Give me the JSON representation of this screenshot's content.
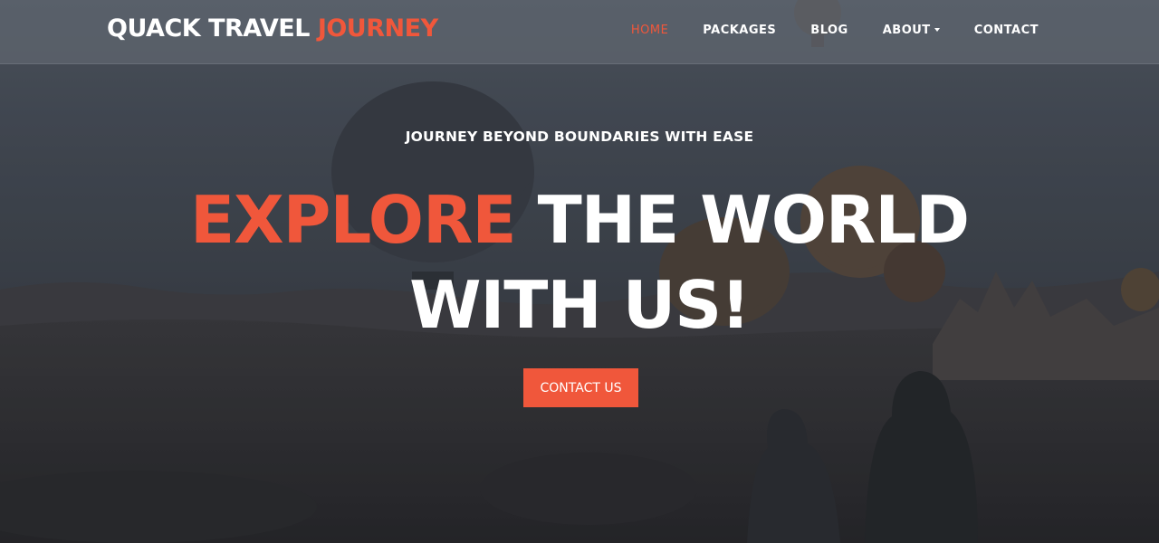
{
  "brand": {
    "part1": "QUACK TRAVEL",
    "part2": "JOURNEY"
  },
  "nav": {
    "items": [
      {
        "label": "HOME",
        "active": true
      },
      {
        "label": "PACKAGES",
        "active": false
      },
      {
        "label": "BLOG",
        "active": false
      },
      {
        "label": "ABOUT",
        "active": false,
        "dropdown": true
      },
      {
        "label": "CONTACT",
        "active": false
      }
    ]
  },
  "hero": {
    "tagline": "JOURNEY BEYOND BOUNDARIES WITH EASE",
    "headline_accent": "EXPLORE",
    "headline_rest": "THE WORLD",
    "headline_line2": "WITH US!",
    "cta_label": "CONTACT US",
    "background_image": "hot-air-balloons-valley-two-people"
  },
  "colors": {
    "accent": "#f0573b",
    "text": "#ffffff",
    "navbar": "#60666f"
  }
}
